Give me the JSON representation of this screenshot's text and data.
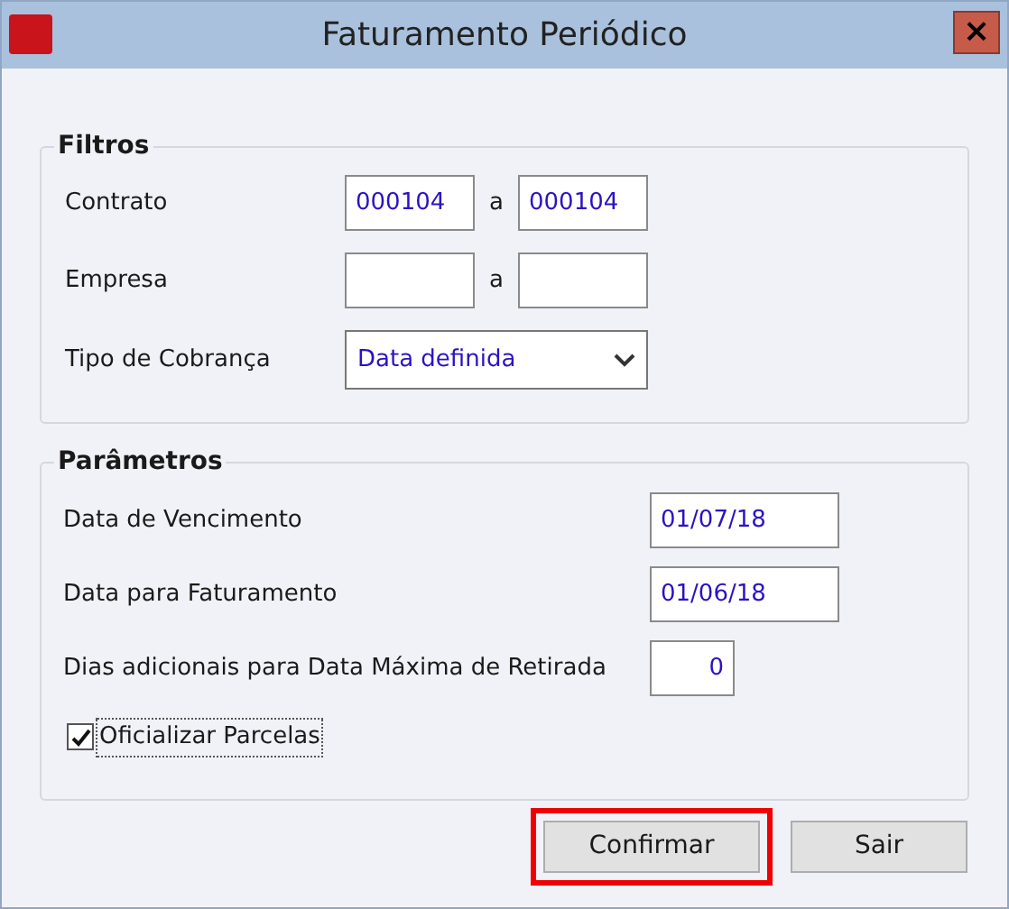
{
  "window": {
    "title": "Faturamento Periódico",
    "close": "×"
  },
  "filtros": {
    "title": "Filtros",
    "rows": [
      {
        "kind": "range",
        "label": "Contrato",
        "from": "000104",
        "sep": "a",
        "to": "000104"
      },
      {
        "kind": "range",
        "label": "Empresa",
        "sep": "a"
      },
      {
        "kind": "select",
        "label": "Tipo de Cobrança",
        "value": "Data definida"
      }
    ]
  },
  "parametros": {
    "title": "Parâmetros",
    "rows": [
      {
        "kind": "date",
        "label": "Data de Vencimento",
        "value": "01/07/18"
      },
      {
        "kind": "date",
        "label": "Data para Faturamento",
        "value": "01/06/18"
      },
      {
        "kind": "number",
        "label": "Dias adicionais para Data Máxima de Retirada",
        "value": "0"
      },
      {
        "kind": "checkbox",
        "label": "Oficializar Parcelas",
        "checked": true
      }
    ]
  },
  "buttons": [
    {
      "label": "Confirmar",
      "highlighted": true
    },
    {
      "label": "Sair",
      "highlighted": false
    }
  ]
}
